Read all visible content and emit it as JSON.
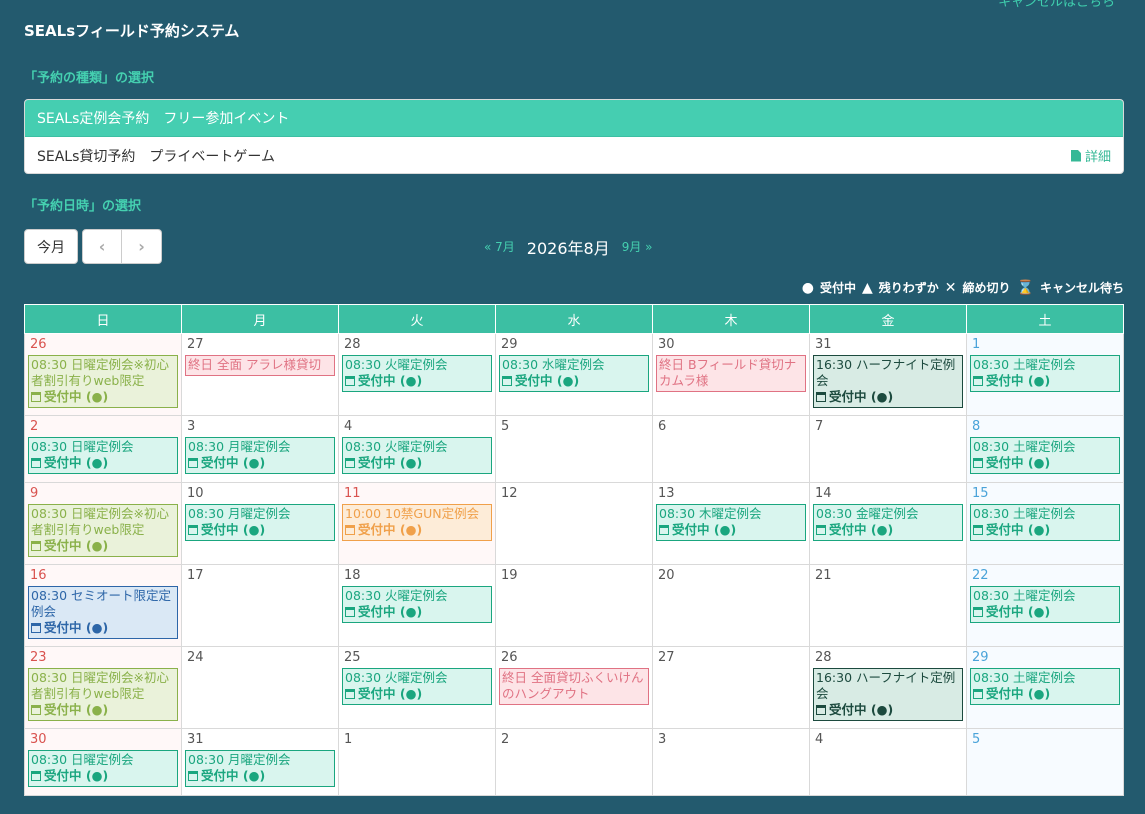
{
  "header": {
    "cancel_link": "キャンセルはこちら",
    "title": "SEALsフィールド予約システム"
  },
  "sections": {
    "type_label": "「予約の種類」の選択",
    "date_label": "「予約日時」の選択"
  },
  "types": [
    {
      "label": "SEALs定例会予約　フリー参加イベント",
      "active": true
    },
    {
      "label": "SEALs貸切予約　プライベートゲーム",
      "active": false,
      "detail": "詳細"
    }
  ],
  "toolbar": {
    "today": "今月",
    "prev_icon": "chevron-left-icon",
    "next_icon": "chevron-right-icon",
    "prev_month": "« 7月",
    "current_month": "2026年8月",
    "next_month": "9月 »"
  },
  "legend": [
    {
      "symbol": "●",
      "label": "受付中"
    },
    {
      "symbol": "▲",
      "label": "残りわずか"
    },
    {
      "symbol": "✕",
      "label": "締め切り"
    },
    {
      "symbol": "⌛",
      "label": "キャンセル待ち"
    }
  ],
  "weekdays": [
    "日",
    "月",
    "火",
    "水",
    "木",
    "金",
    "土"
  ],
  "weeks": [
    [
      {
        "day": "26",
        "bg": "sun",
        "events": [
          {
            "title": "08:30 日曜定例会※初心者割引有りweb限定",
            "status": "受付中 (●)",
            "color": "olive"
          }
        ]
      },
      {
        "day": "27",
        "events": [
          {
            "title": "終日 全面 アラレ様貸切",
            "color": "pink"
          }
        ]
      },
      {
        "day": "28",
        "events": [
          {
            "title": "08:30 火曜定例会",
            "status": "受付中 (●)",
            "color": "green"
          }
        ]
      },
      {
        "day": "29",
        "events": [
          {
            "title": "08:30 水曜定例会",
            "status": "受付中 (●)",
            "color": "green"
          }
        ]
      },
      {
        "day": "30",
        "events": [
          {
            "title": "終日 Bフィールド貸切ナカムラ様",
            "color": "pink"
          }
        ]
      },
      {
        "day": "31",
        "events": [
          {
            "title": "16:30 ハーフナイト定例会",
            "status": "受付中 (●)",
            "color": "dark"
          }
        ]
      },
      {
        "day": "1",
        "bg": "sat",
        "events": [
          {
            "title": "08:30 土曜定例会",
            "status": "受付中 (●)",
            "color": "green"
          }
        ]
      }
    ],
    [
      {
        "day": "2",
        "bg": "sun",
        "events": [
          {
            "title": "08:30 日曜定例会",
            "status": "受付中 (●)",
            "color": "green"
          }
        ]
      },
      {
        "day": "3",
        "events": [
          {
            "title": "08:30 月曜定例会",
            "status": "受付中 (●)",
            "color": "green"
          }
        ]
      },
      {
        "day": "4",
        "events": [
          {
            "title": "08:30 火曜定例会",
            "status": "受付中 (●)",
            "color": "green"
          }
        ]
      },
      {
        "day": "5",
        "events": []
      },
      {
        "day": "6",
        "events": []
      },
      {
        "day": "7",
        "events": []
      },
      {
        "day": "8",
        "bg": "sat",
        "events": [
          {
            "title": "08:30 土曜定例会",
            "status": "受付中 (●)",
            "color": "green"
          }
        ]
      }
    ],
    [
      {
        "day": "9",
        "bg": "sun",
        "events": [
          {
            "title": "08:30 日曜定例会※初心者割引有りweb限定",
            "status": "受付中 (●)",
            "color": "olive"
          }
        ]
      },
      {
        "day": "10",
        "events": [
          {
            "title": "08:30 月曜定例会",
            "status": "受付中 (●)",
            "color": "green"
          }
        ]
      },
      {
        "day": "11",
        "bg": "hol",
        "events": [
          {
            "title": "10:00 10禁GUN定例会",
            "status": "受付中 (●)",
            "color": "orange"
          }
        ]
      },
      {
        "day": "12",
        "events": []
      },
      {
        "day": "13",
        "events": [
          {
            "title": "08:30 木曜定例会",
            "status": "受付中 (●)",
            "color": "green"
          }
        ]
      },
      {
        "day": "14",
        "events": [
          {
            "title": "08:30 金曜定例会",
            "status": "受付中 (●)",
            "color": "green"
          }
        ]
      },
      {
        "day": "15",
        "bg": "sat",
        "events": [
          {
            "title": "08:30 土曜定例会",
            "status": "受付中 (●)",
            "color": "green"
          }
        ]
      }
    ],
    [
      {
        "day": "16",
        "bg": "sun",
        "events": [
          {
            "title": "08:30 セミオート限定定例会",
            "status": "受付中 (●)",
            "color": "blue"
          }
        ]
      },
      {
        "day": "17",
        "events": []
      },
      {
        "day": "18",
        "events": [
          {
            "title": "08:30 火曜定例会",
            "status": "受付中 (●)",
            "color": "green"
          }
        ]
      },
      {
        "day": "19",
        "events": []
      },
      {
        "day": "20",
        "events": []
      },
      {
        "day": "21",
        "events": []
      },
      {
        "day": "22",
        "bg": "sat",
        "events": [
          {
            "title": "08:30 土曜定例会",
            "status": "受付中 (●)",
            "color": "green"
          }
        ]
      }
    ],
    [
      {
        "day": "23",
        "bg": "sun",
        "events": [
          {
            "title": "08:30 日曜定例会※初心者割引有りweb限定",
            "status": "受付中 (●)",
            "color": "olive"
          }
        ]
      },
      {
        "day": "24",
        "events": []
      },
      {
        "day": "25",
        "events": [
          {
            "title": "08:30 火曜定例会",
            "status": "受付中 (●)",
            "color": "green"
          }
        ]
      },
      {
        "day": "26",
        "events": [
          {
            "title": "終日 全面貸切ふくいけんのハングアウト",
            "color": "pink"
          }
        ]
      },
      {
        "day": "27",
        "events": []
      },
      {
        "day": "28",
        "events": [
          {
            "title": "16:30 ハーフナイト定例会",
            "status": "受付中 (●)",
            "color": "dark"
          }
        ]
      },
      {
        "day": "29",
        "bg": "sat",
        "events": [
          {
            "title": "08:30 土曜定例会",
            "status": "受付中 (●)",
            "color": "green"
          }
        ]
      }
    ],
    [
      {
        "day": "30",
        "bg": "sun",
        "events": [
          {
            "title": "08:30 日曜定例会",
            "status": "受付中 (●)",
            "color": "green"
          }
        ]
      },
      {
        "day": "31",
        "events": [
          {
            "title": "08:30 月曜定例会",
            "status": "受付中 (●)",
            "color": "green"
          }
        ]
      },
      {
        "day": "1",
        "events": []
      },
      {
        "day": "2",
        "events": []
      },
      {
        "day": "3",
        "events": []
      },
      {
        "day": "4",
        "events": []
      },
      {
        "day": "5",
        "bg": "sat",
        "events": []
      }
    ]
  ],
  "colors": {
    "background": "#235a6e",
    "accent": "#45ceb1",
    "header_row": "#3cbfa3"
  }
}
